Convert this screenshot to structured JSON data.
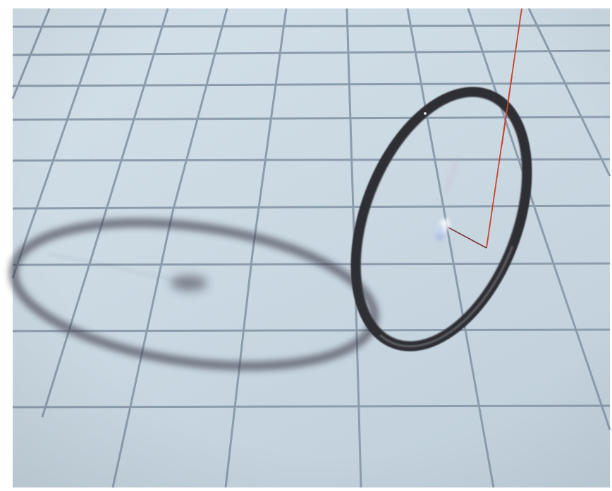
{
  "scene": {
    "colors": {
      "background": "#ffffff",
      "floor_light": "#d4e1ea",
      "floor_dark": "#c2d1dc",
      "grid_line": "#8b9cad",
      "shadow": "#3c3d4a",
      "ring": "#3a3a3f",
      "ring_highlight": "#7b7b82",
      "string": "#c8452e",
      "inner_wire": "#7a3a3a",
      "glow": "#ffffff"
    },
    "elements": [
      "floor",
      "grid",
      "ring-shadow",
      "ring",
      "suspension-string",
      "center-glow"
    ]
  }
}
